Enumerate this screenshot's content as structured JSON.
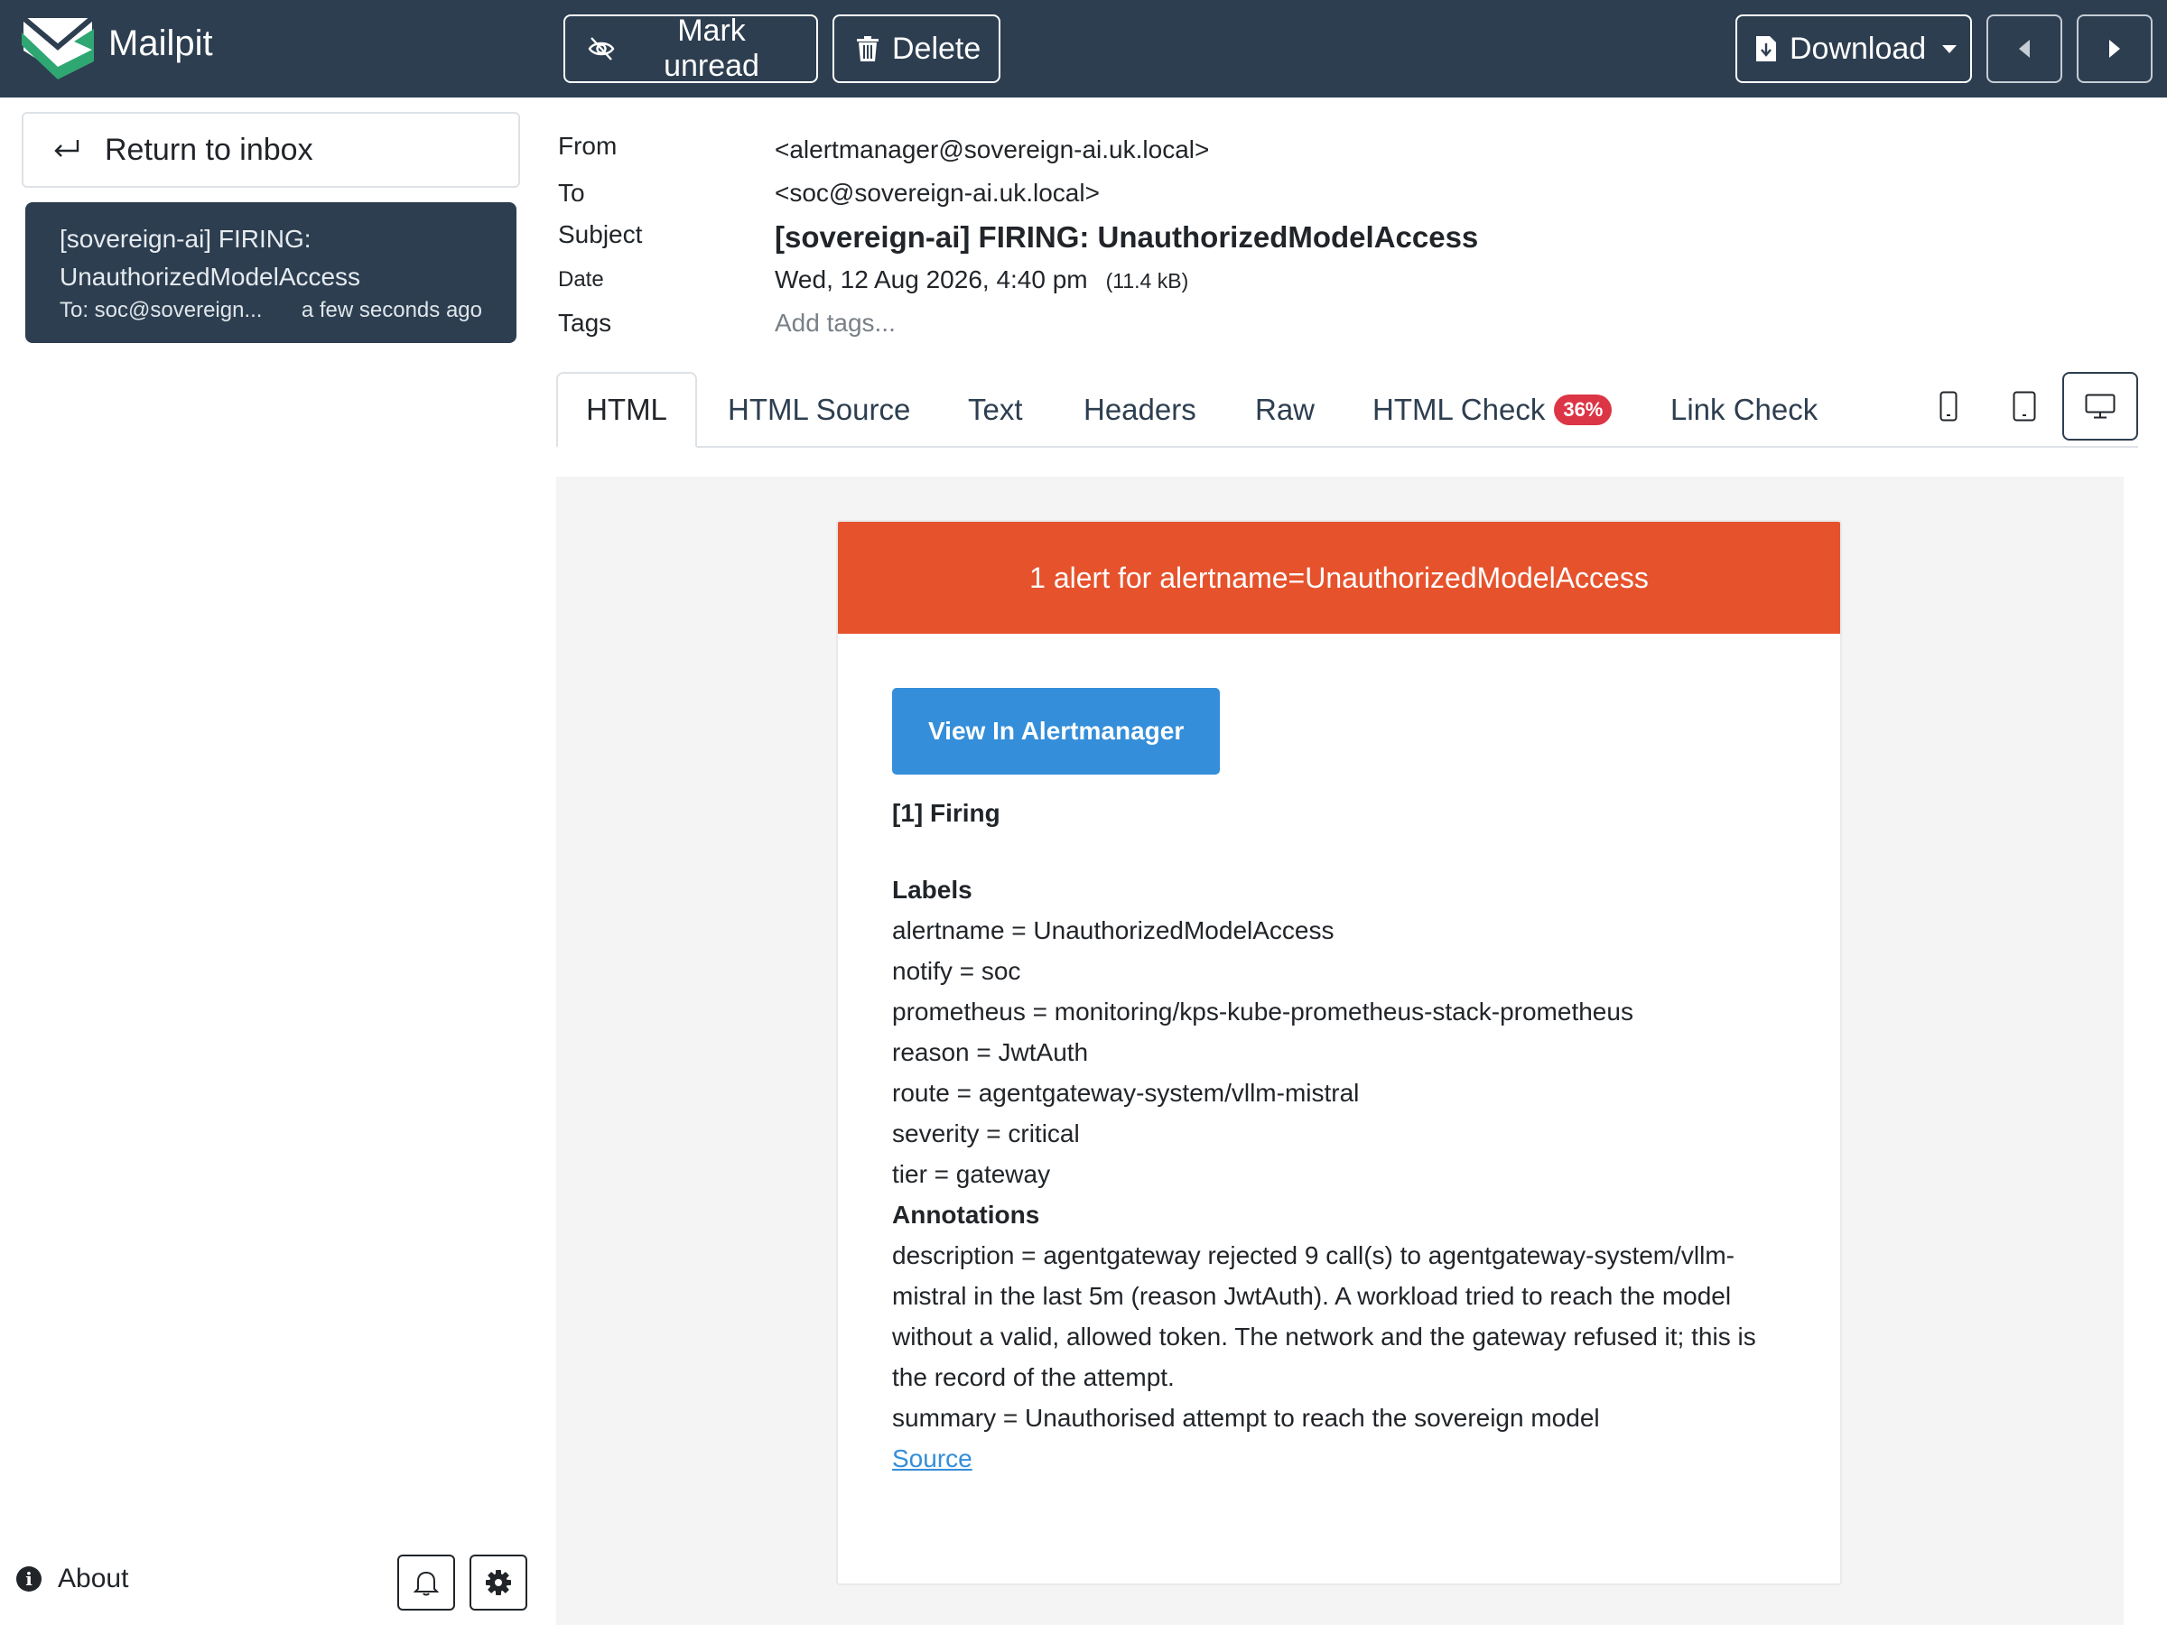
{
  "app": {
    "name": "Mailpit"
  },
  "toolbar": {
    "mark_unread": "Mark unread",
    "delete": "Delete",
    "download": "Download"
  },
  "sidebar": {
    "return_label": "Return to inbox",
    "message": {
      "subject": "[sovereign-ai] FIRING: UnauthorizedModelAccess",
      "to": "To: soc@sovereign...",
      "time": "a few seconds ago"
    },
    "about": "About"
  },
  "headers": {
    "from_label": "From",
    "from_value": "<alertmanager@sovereign-ai.uk.local>",
    "to_label": "To",
    "to_value": "<soc@sovereign-ai.uk.local>",
    "subject_label": "Subject",
    "subject_value": "[sovereign-ai] FIRING: UnauthorizedModelAccess",
    "date_label": "Date",
    "date_value": "Wed, 12 Aug 2026, 4:40 pm",
    "size": "(11.4 kB)",
    "tags_label": "Tags",
    "tags_placeholder": "Add tags..."
  },
  "tabs": [
    {
      "label": "HTML"
    },
    {
      "label": "HTML Source"
    },
    {
      "label": "Text"
    },
    {
      "label": "Headers"
    },
    {
      "label": "Raw"
    },
    {
      "label": "HTML Check",
      "badge": "36%"
    },
    {
      "label": "Link Check"
    }
  ],
  "email": {
    "banner": "1 alert for alertname=UnauthorizedModelAccess",
    "view_button": "View In Alertmanager",
    "firing": "[1] Firing",
    "labels_heading": "Labels",
    "labels": [
      "alertname = UnauthorizedModelAccess",
      "notify = soc",
      "prometheus = monitoring/kps-kube-prometheus-stack-prometheus",
      "reason = JwtAuth",
      "route = agentgateway-system/vllm-mistral",
      "severity = critical",
      "tier = gateway"
    ],
    "annotations_heading": "Annotations",
    "description": "description = agentgateway rejected 9 call(s) to agentgateway-system/vllm-mistral in the last 5m (reason JwtAuth). A workload tried to reach the model without a valid, allowed token. The network and the gateway refused it; this is the record of the attempt.",
    "summary": "summary = Unauthorised attempt to reach the sovereign model",
    "source_link": "Source"
  },
  "colors": {
    "topbar": "#2d3e50",
    "alert_banner": "#e6522c",
    "view_button": "#348eda",
    "badge": "#dc3545",
    "preview_bg": "#f4f4f4"
  }
}
